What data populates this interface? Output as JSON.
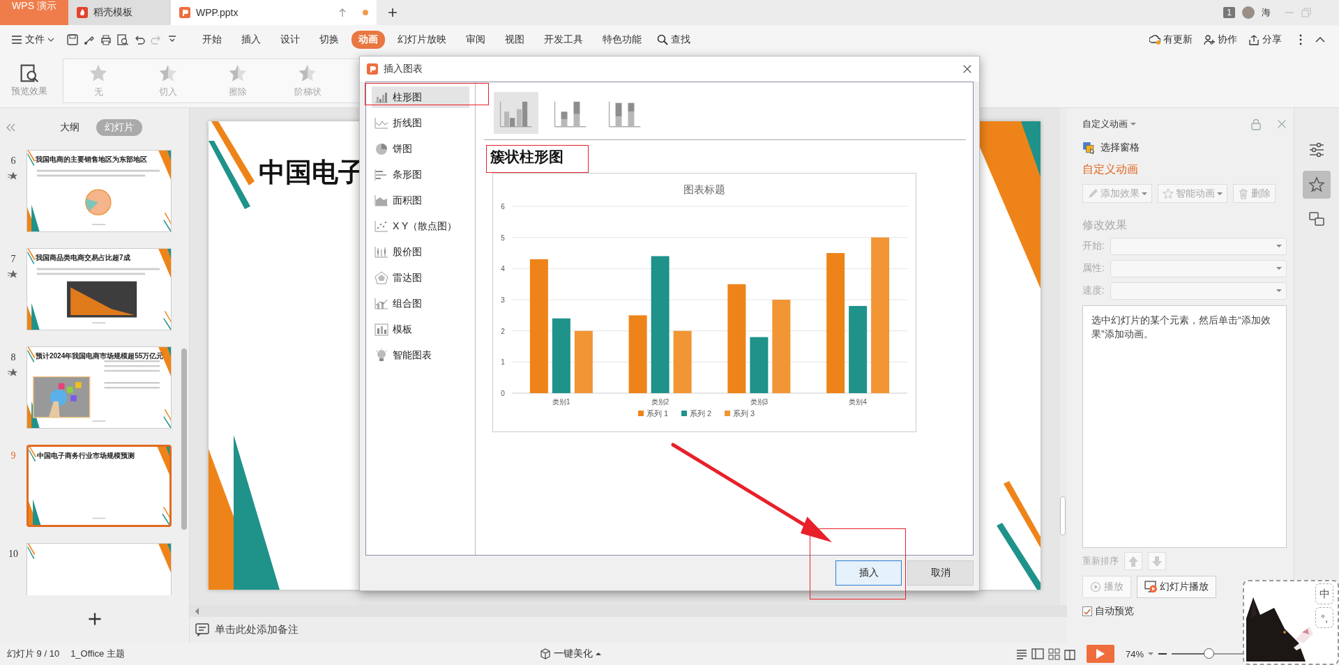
{
  "doc_tabs": [
    {
      "label": "WPS 演示",
      "kind": "app",
      "selected": false,
      "modified": false
    },
    {
      "label": "稻壳模板",
      "kind": "store",
      "selected": false,
      "modified": false
    },
    {
      "label": "WPP.pptx",
      "kind": "doc",
      "selected": true,
      "modified": true
    }
  ],
  "account": {
    "badge": "1",
    "user": "海"
  },
  "menu": {
    "file": "文件",
    "tabs": [
      {
        "label": "开始",
        "selected": false
      },
      {
        "label": "插入",
        "selected": false
      },
      {
        "label": "设计",
        "selected": false
      },
      {
        "label": "切换",
        "selected": false
      },
      {
        "label": "动画",
        "selected": true
      },
      {
        "label": "幻灯片放映",
        "selected": false
      },
      {
        "label": "审阅",
        "selected": false
      },
      {
        "label": "视图",
        "selected": false
      },
      {
        "label": "开发工具",
        "selected": false
      },
      {
        "label": "特色功能",
        "selected": false
      }
    ],
    "search": "查找",
    "actions": [
      {
        "label": "有更新",
        "kind": "update"
      },
      {
        "label": "协作",
        "kind": "collab"
      },
      {
        "label": "分享",
        "kind": "share"
      }
    ]
  },
  "ribbon": {
    "preview": "预览效果",
    "effects": [
      "无",
      "切入",
      "擦除",
      "阶梯状"
    ]
  },
  "slide_panel": {
    "view_tabs": [
      {
        "label": "大纲",
        "selected": false
      },
      {
        "label": "幻灯片",
        "selected": true
      }
    ],
    "slides": [
      {
        "number": "6",
        "title": "我国电商的主要销售地区为东部地区",
        "kind": "pie",
        "animated": true,
        "selected": false
      },
      {
        "number": "7",
        "title": "我国商品类电商交易占比超7成",
        "kind": "area",
        "animated": true,
        "selected": false
      },
      {
        "number": "8",
        "title": "预计2024年我国电商市场规模超55万亿元",
        "animated": true,
        "selected": false
      },
      {
        "number": "9",
        "title": "中国电子商务行业市场规模预测",
        "kind": "blank",
        "animated": false,
        "selected": true
      },
      {
        "number": "10",
        "selected": false
      }
    ]
  },
  "editor": {
    "slide_title": "中国电子",
    "notes_placeholder": "单击此处添加备注"
  },
  "dialog": {
    "title": "插入图表",
    "types": [
      {
        "label": "柱形图",
        "kind": "bar",
        "selected": true
      },
      {
        "label": "折线图",
        "kind": "line",
        "selected": false
      },
      {
        "label": "饼图",
        "kind": "pie",
        "selected": false
      },
      {
        "label": "条形图",
        "kind": "hbar",
        "selected": false
      },
      {
        "label": "面积图",
        "kind": "area",
        "selected": false
      },
      {
        "label": "X Y（散点图）",
        "kind": "scatter",
        "selected": false
      },
      {
        "label": "股价图",
        "kind": "stock",
        "selected": false
      },
      {
        "label": "雷达图",
        "kind": "radar",
        "selected": false
      },
      {
        "label": "组合图",
        "kind": "combo",
        "selected": false
      },
      {
        "label": "模板",
        "kind": "template",
        "selected": false
      },
      {
        "label": "智能图表",
        "kind": "smart",
        "selected": false
      }
    ],
    "subtypes": [
      {
        "kind": "clustered",
        "selected": true
      },
      {
        "kind": "stacked",
        "selected": false
      },
      {
        "kind": "percent",
        "selected": false
      }
    ],
    "subtype_name": "簇状柱形图",
    "chart_data": {
      "type": "bar",
      "title": "图表标题",
      "categories": [
        "类别1",
        "类别2",
        "类别3",
        "类别4"
      ],
      "series": [
        {
          "name": "系列 1",
          "color": "#ee8419",
          "values": [
            4.3,
            2.5,
            3.5,
            4.5
          ]
        },
        {
          "name": "系列 2",
          "color": "#1f928a",
          "values": [
            2.4,
            4.4,
            1.8,
            2.8
          ]
        },
        {
          "name": "系列 3",
          "color": "#f19535",
          "values": [
            2,
            2,
            3,
            5
          ]
        }
      ],
      "ylim": [
        0,
        6
      ],
      "yticks": [
        {
          "value": 0,
          "label": "0"
        },
        {
          "value": 1,
          "label": "1"
        },
        {
          "value": 2,
          "label": "2"
        },
        {
          "value": 3,
          "label": "3"
        },
        {
          "value": 4,
          "label": "4"
        },
        {
          "value": 5,
          "label": "5"
        },
        {
          "value": 6,
          "label": "6"
        }
      ],
      "grid": true,
      "legend": true
    },
    "buttons": [
      {
        "label": "插入",
        "kind": "primary"
      },
      {
        "label": "取消",
        "kind": "secondary"
      }
    ]
  },
  "animation_pane": {
    "header": "自定义动画",
    "selection_pane": "选择窗格",
    "section": "自定义动画",
    "actions": [
      {
        "label": "添加效果",
        "kind": "add",
        "disabled": true
      },
      {
        "label": "智能动画",
        "kind": "smart",
        "disabled": true
      },
      {
        "label": "删除",
        "kind": "delete",
        "disabled": true
      }
    ],
    "modify": "修改效果",
    "fields": [
      "开始:",
      "属性:",
      "速度:"
    ],
    "hint": "选中幻灯片的某个元素，然后单击“添加效果”添加动画。",
    "reorder": "重新排序",
    "play": "播放",
    "slideshow": "幻灯片播放",
    "auto_preview": {
      "label": "自动预览",
      "checked": true
    }
  },
  "side_strip": [
    {
      "kind": "sliders",
      "selected": false
    },
    {
      "kind": "star",
      "selected": true
    },
    {
      "kind": "swap",
      "selected": false
    }
  ],
  "status_bar": {
    "slide": "幻灯片 9 / 10",
    "theme": "1_Office 主题",
    "beautify": "一键美化",
    "zoom": "74%",
    "level": 0.35
  },
  "ime": {
    "keys": [
      "中",
      "°,"
    ]
  }
}
